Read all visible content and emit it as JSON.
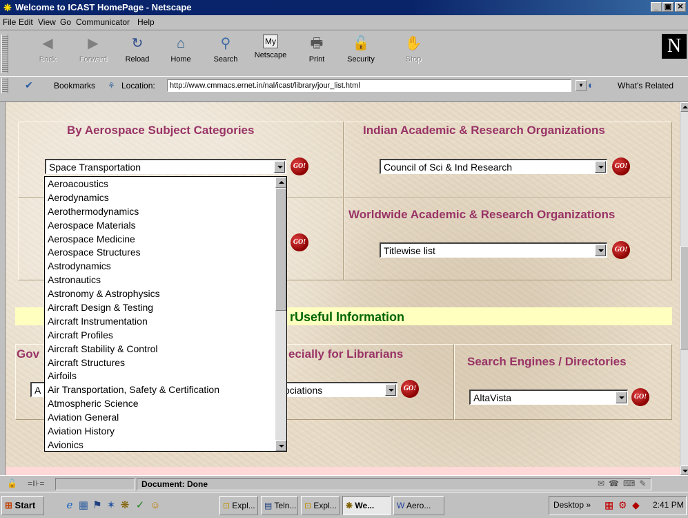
{
  "window": {
    "title": "Welcome to ICAST HomePage - Netscape",
    "minimize": "_",
    "maximize": "▣",
    "close": "✕"
  },
  "menu": [
    "File",
    "Edit",
    "View",
    "Go",
    "Communicator",
    "Help"
  ],
  "toolbar": {
    "buttons": [
      {
        "label": "Back",
        "icon": "back-arrow-icon",
        "enabled": false
      },
      {
        "label": "Forward",
        "icon": "forward-arrow-icon",
        "enabled": false
      },
      {
        "label": "Reload",
        "icon": "reload-icon",
        "enabled": true
      },
      {
        "label": "Home",
        "icon": "home-icon",
        "enabled": true
      },
      {
        "label": "Search",
        "icon": "search-icon",
        "enabled": true
      },
      {
        "label": "Netscape",
        "icon": "my-netscape-icon",
        "enabled": true
      },
      {
        "label": "Print",
        "icon": "print-icon",
        "enabled": true
      },
      {
        "label": "Security",
        "icon": "lock-icon",
        "enabled": true
      },
      {
        "label": "Stop",
        "icon": "stop-icon",
        "enabled": false
      }
    ],
    "logo": "N"
  },
  "location": {
    "bookmarks_label": "Bookmarks",
    "location_label": "Location:",
    "url": "http://www.cmmacs.ernet.in/nal/icast/library/jour_list.html",
    "whats_related": "What's Related"
  },
  "page": {
    "subject_heading": "By Aerospace Subject Categories",
    "subject_selected": "Space Transportation",
    "indian_heading": "Indian Academic & Research Organizations",
    "indian_selected": "Council of Sci & Ind Research",
    "worldwide_heading": "Worldwide Academic & Research Organizations",
    "worldwide_selected": "Titlewise list",
    "useful_heading": "rUseful Information",
    "gov_heading_fragment": "Gov",
    "gov_selected_fragment": "A",
    "librarians_heading_fragment": "ecially for Librarians",
    "librarians_selected_fragment": "ociations",
    "search_heading": "Search Engines / Directories",
    "search_selected": "AltaVista",
    "go_label": "GO!"
  },
  "dropdown_items": [
    "Aeroacoustics",
    "Aerodynamics",
    "Aerothermodynamics",
    "Aerospace Materials",
    "Aerospace Medicine",
    "Aerospace Structures",
    "Astrodynamics",
    "Astronautics",
    "Astronomy & Astrophysics",
    "Aircraft Design & Testing",
    "Aircraft Instrumentation",
    "Aircraft Profiles",
    "Aircraft Stability & Control",
    "Aircraft Structures",
    "Airfoils",
    "Air Transportation, Safety & Certification",
    "Atmospheric Science",
    "Aviation General",
    "Aviation History",
    "Avionics"
  ],
  "status": {
    "text": "Document: Done"
  },
  "taskbar": {
    "start": "Start",
    "tasks": [
      {
        "label": "Expl...",
        "active": false
      },
      {
        "label": "Teln...",
        "active": false
      },
      {
        "label": "Expl...",
        "active": false
      },
      {
        "label": "We...",
        "active": true
      },
      {
        "label": "Aero...",
        "active": false
      }
    ],
    "desktop": "Desktop »",
    "clock": "2:41 PM"
  },
  "colors": {
    "heading": "#993366",
    "useful": "#006600",
    "titlebar": "#0a246a"
  }
}
